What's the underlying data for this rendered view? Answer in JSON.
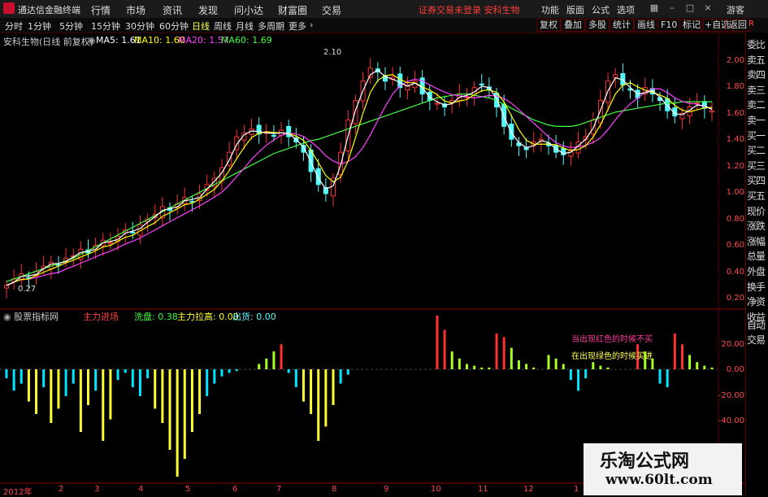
{
  "app": {
    "title": "通达信金融终端"
  },
  "menu": [
    "行情",
    "市场",
    "资讯",
    "发现",
    "问小达",
    "财富圈",
    "交易"
  ],
  "notice": "证券交易未登录  安科生物",
  "menu_right": [
    "功能",
    "版面",
    "公式",
    "选项",
    "游客"
  ],
  "periods": [
    "分时",
    "1分钟",
    "5分钟",
    "15分钟",
    "30分钟",
    "60分钟",
    "日线",
    "周线",
    "月线",
    "多周期",
    "更多"
  ],
  "active_period": "日线",
  "toolbar_right": [
    "复权",
    "叠加",
    "多股",
    "统计",
    "画线",
    "F10",
    "标记",
    "+自选",
    "返回"
  ],
  "main": {
    "stock_label": "安科生物(日线 前复权)",
    "ma5": "MA5: 1.61",
    "ma10": "MA10: 1.60",
    "ma20": "MA20: 1.57",
    "ma60": "MA60: 1.69",
    "high_mark": "2.10",
    "low_mark": "0.27",
    "yaxis": [
      "2.00",
      "1.80",
      "1.60",
      "1.40",
      "1.20",
      "1.00",
      "0.80",
      "0.60",
      "0.40",
      "0.20"
    ]
  },
  "indicator": {
    "title": "股票指标网",
    "main_enter": "主力进场",
    "wash": "洗盘: 0.38",
    "pull": "主力拉高: 0.00",
    "exit": "出货: 0.00",
    "note_red": "当出现红色的时候不买",
    "note_green": "在出现绿色的时候买进",
    "yaxis": [
      "20.00",
      "0.00",
      "-20.00",
      "-40.00"
    ]
  },
  "right_panel": [
    "委比",
    "卖五",
    "卖四",
    "卖三",
    "卖二",
    "卖一",
    "买一",
    "买二",
    "买三",
    "买四",
    "买五",
    "现价",
    "涨跌",
    "涨幅",
    "总量",
    "外盘",
    "换手",
    "净资",
    "收益"
  ],
  "right_panel_bottom": [
    "自动",
    "交易"
  ],
  "right_axis_top": "R",
  "xaxis": [
    "2012年",
    "2",
    "3",
    "4",
    "5",
    "6",
    "7",
    "8",
    "9",
    "10",
    "11",
    "12",
    "1"
  ],
  "watermark": {
    "line1": "乐淘公式网",
    "line2": "www.60lt.com"
  },
  "colors": {
    "up": "#ff3030",
    "down": "#54fcfc",
    "ma5": "#ffffff",
    "ma10": "#ffff00",
    "ma20": "#ff40ff",
    "ma60": "#40ff40",
    "ind_cyan": "#00e5ff",
    "ind_yellow": "#ffff30",
    "ind_green": "#a8ff20"
  },
  "chart_data": {
    "type": "candlestick",
    "ylim": [
      0.15,
      2.15
    ],
    "close": [
      0.27,
      0.32,
      0.36,
      0.33,
      0.38,
      0.42,
      0.45,
      0.43,
      0.48,
      0.5,
      0.55,
      0.52,
      0.58,
      0.62,
      0.6,
      0.65,
      0.7,
      0.68,
      0.74,
      0.78,
      0.82,
      0.88,
      0.85,
      0.9,
      0.95,
      0.92,
      0.98,
      1.05,
      1.1,
      1.18,
      1.3,
      1.42,
      1.45,
      1.48,
      1.44,
      1.46,
      1.43,
      1.47,
      1.42,
      1.38,
      1.3,
      1.15,
      1.05,
      0.98,
      1.1,
      1.3,
      1.55,
      1.7,
      1.85,
      1.95,
      1.92,
      1.85,
      1.88,
      1.8,
      1.82,
      1.85,
      1.75,
      1.7,
      1.68,
      1.65,
      1.7,
      1.75,
      1.73,
      1.8,
      1.82,
      1.78,
      1.65,
      1.5,
      1.4,
      1.35,
      1.32,
      1.38,
      1.4,
      1.35,
      1.3,
      1.28,
      1.32,
      1.38,
      1.42,
      1.55,
      1.7,
      1.85,
      1.9,
      1.82,
      1.78,
      1.72,
      1.8,
      1.75,
      1.7,
      1.62,
      1.58,
      1.6,
      1.65,
      1.68,
      1.64,
      1.62
    ],
    "ma60": [
      0.3,
      0.32,
      0.34,
      0.36,
      0.38,
      0.4,
      0.42,
      0.44,
      0.46,
      0.48,
      0.51,
      0.54,
      0.57,
      0.6,
      0.63,
      0.66,
      0.69,
      0.72,
      0.75,
      0.78,
      0.81,
      0.84,
      0.87,
      0.9,
      0.93,
      0.96,
      0.99,
      1.02,
      1.05,
      1.08,
      1.11,
      1.14,
      1.17,
      1.2,
      1.23,
      1.26,
      1.29,
      1.31,
      1.33,
      1.35,
      1.37,
      1.39,
      1.4,
      1.42,
      1.44,
      1.46,
      1.48,
      1.5,
      1.52,
      1.54,
      1.56,
      1.58,
      1.6,
      1.62,
      1.64,
      1.66,
      1.68,
      1.7,
      1.72,
      1.73,
      1.74,
      1.75,
      1.75,
      1.74,
      1.73,
      1.72,
      1.7,
      1.67,
      1.64,
      1.61,
      1.58,
      1.55,
      1.53,
      1.51,
      1.5,
      1.5,
      1.5,
      1.51,
      1.53,
      1.55,
      1.57,
      1.59,
      1.61,
      1.62,
      1.63,
      1.64,
      1.65,
      1.66,
      1.67,
      1.68,
      1.68,
      1.69,
      1.69,
      1.69,
      1.69,
      1.69
    ],
    "indicator_values": [
      -5,
      -12,
      -8,
      -18,
      -25,
      -10,
      -30,
      -22,
      -15,
      -8,
      -35,
      -20,
      -12,
      -40,
      -28,
      -6,
      -2,
      -10,
      -15,
      -5,
      -22,
      -30,
      -45,
      -60,
      -50,
      -35,
      -25,
      -15,
      -8,
      -4,
      -2,
      -1,
      0,
      0,
      3,
      6,
      10,
      14,
      -2,
      -10,
      -18,
      -25,
      -40,
      -32,
      -20,
      -8,
      -3,
      0,
      0,
      0,
      0,
      0,
      0,
      0,
      0,
      0,
      0,
      0,
      30,
      22,
      10,
      6,
      3,
      2,
      1,
      1,
      20,
      18,
      12,
      5,
      3,
      1,
      0,
      8,
      6,
      3,
      -6,
      -12,
      -5,
      4,
      2,
      1,
      0,
      0,
      0,
      14,
      10,
      6,
      -8,
      -10,
      20,
      14,
      8,
      4,
      2,
      1
    ]
  }
}
